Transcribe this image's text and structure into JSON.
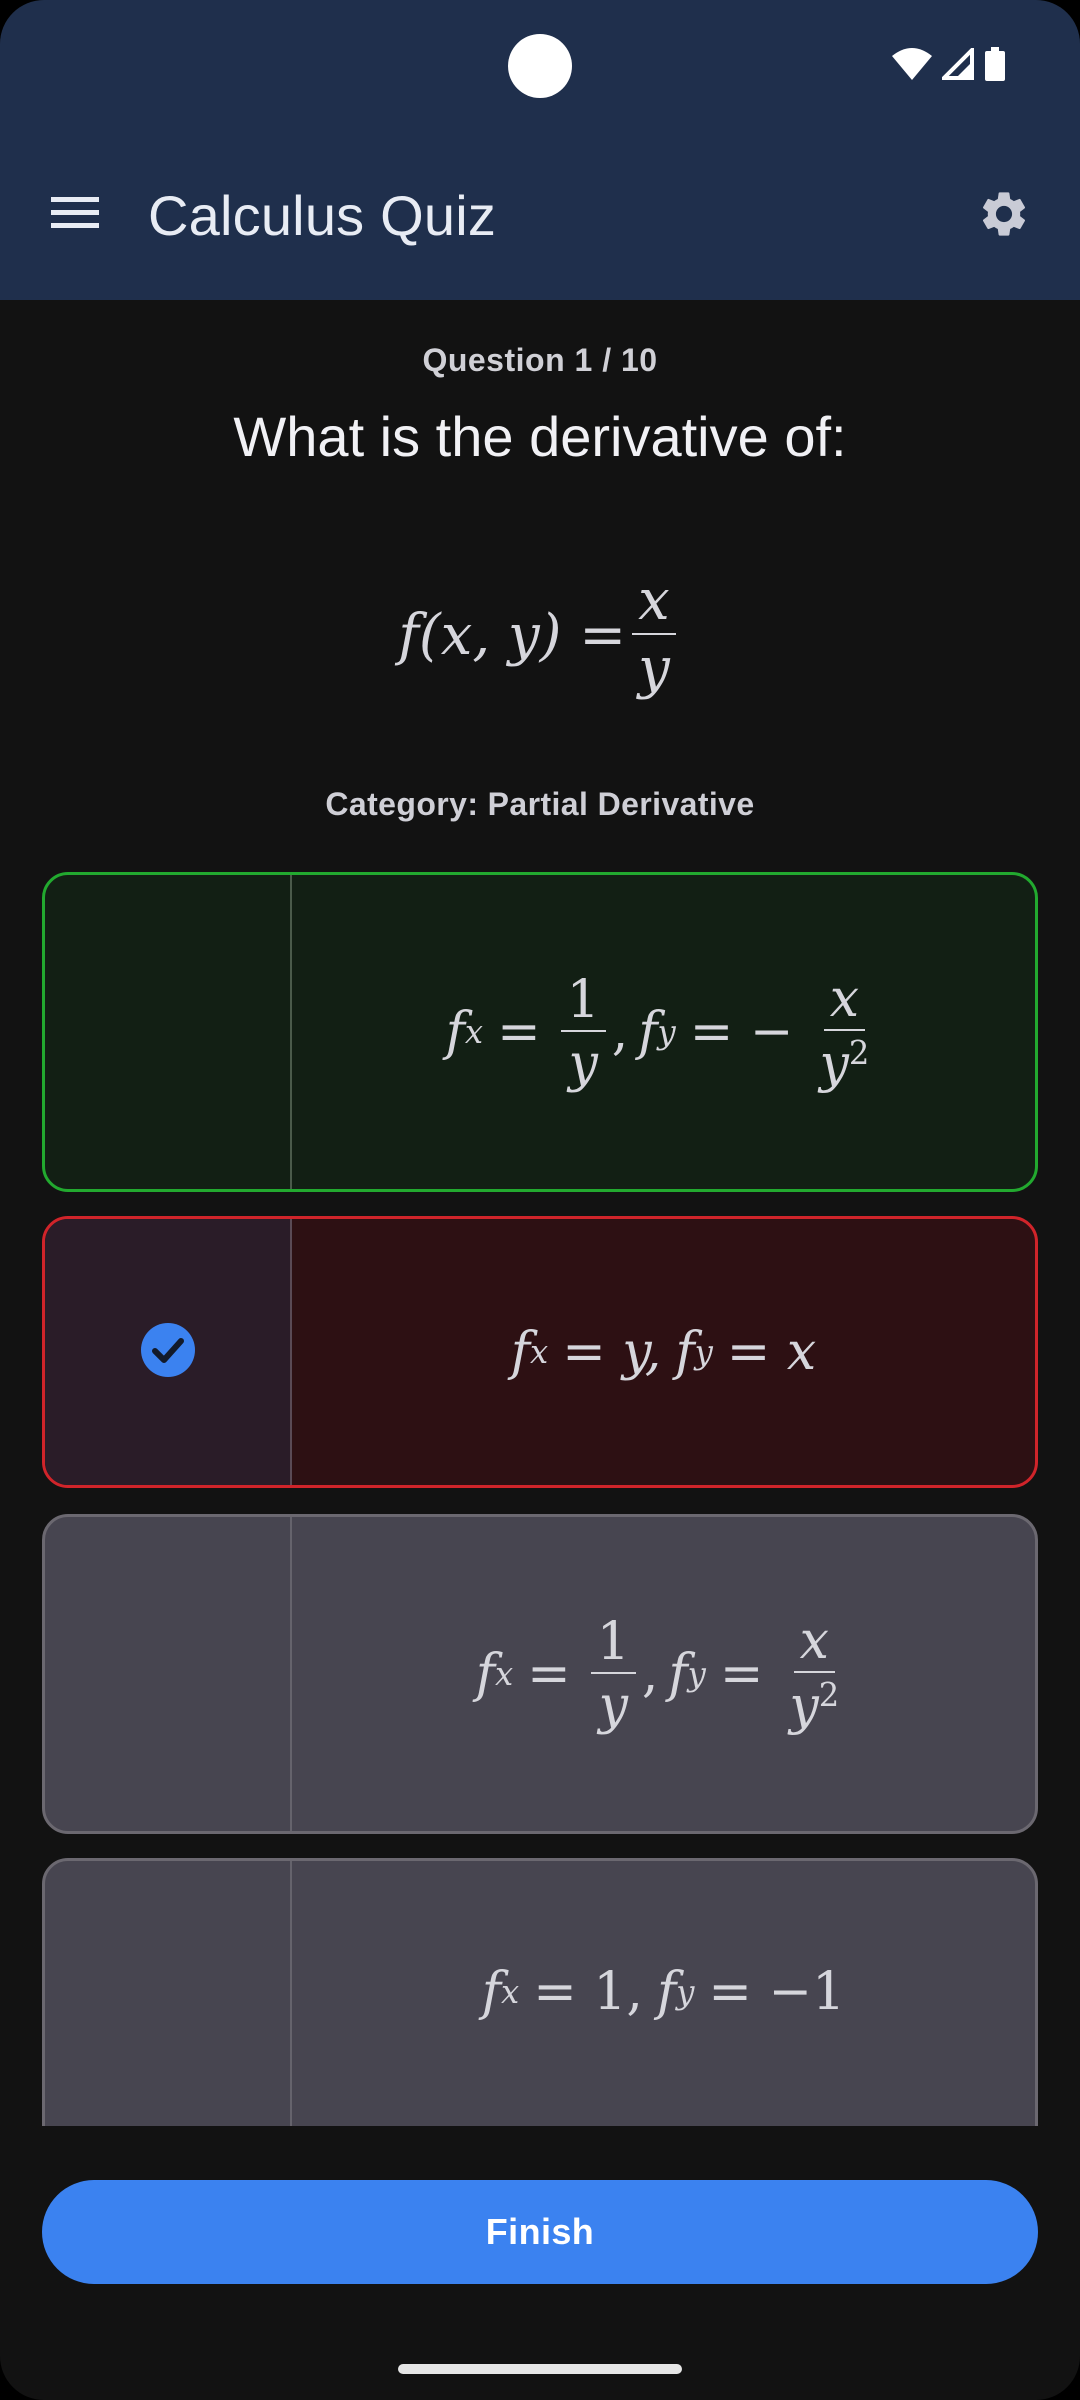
{
  "app": {
    "title": "Calculus Quiz",
    "header_color": "#1f2f4c",
    "accent": "#3b82f0"
  },
  "status_bar": {
    "icons": [
      "wifi-icon",
      "cellular-signal-icon",
      "battery-icon"
    ]
  },
  "quiz": {
    "counter": "Question 1 / 10",
    "prompt": "What is the derivative of:",
    "category": "Category: Partial Derivative",
    "function": {
      "lhs": "f(x, y) =",
      "numerator": "x",
      "denominator": "y"
    },
    "options": [
      {
        "state": "correct",
        "selected": false,
        "parts": {
          "a_lhs": "f",
          "a_sub": "x",
          "a_eq": "=",
          "a_num": "1",
          "a_den": "y",
          "b_lhs": "f",
          "b_sub": "y",
          "b_eq": "= −",
          "b_num": "x",
          "b_den": "y",
          "b_den_sup": "2"
        }
      },
      {
        "state": "wrong",
        "selected": true,
        "parts": {
          "a_lhs": "f",
          "a_sub": "x",
          "a_rhs": "= y,",
          "b_lhs": "f",
          "b_sub": "y",
          "b_rhs": "= x"
        }
      },
      {
        "state": "neutral",
        "selected": false,
        "parts": {
          "a_lhs": "f",
          "a_sub": "x",
          "a_eq": "=",
          "a_num": "1",
          "a_den": "y",
          "b_lhs": "f",
          "b_sub": "y",
          "b_eq": "=",
          "b_num": "x",
          "b_den": "y",
          "b_den_sup": "2"
        }
      },
      {
        "state": "neutral",
        "selected": false,
        "parts": {
          "a_lhs": "f",
          "a_sub": "x",
          "a_rhs": "= 1,",
          "b_lhs": "f",
          "b_sub": "y",
          "b_rhs": "= −1"
        }
      }
    ]
  },
  "actions": {
    "finish_label": "Finish"
  },
  "colors": {
    "correct_border": "#22a92f",
    "wrong_border": "#d0242a",
    "neutral_border": "#6b6870",
    "selected_check": "#3b82f0"
  }
}
